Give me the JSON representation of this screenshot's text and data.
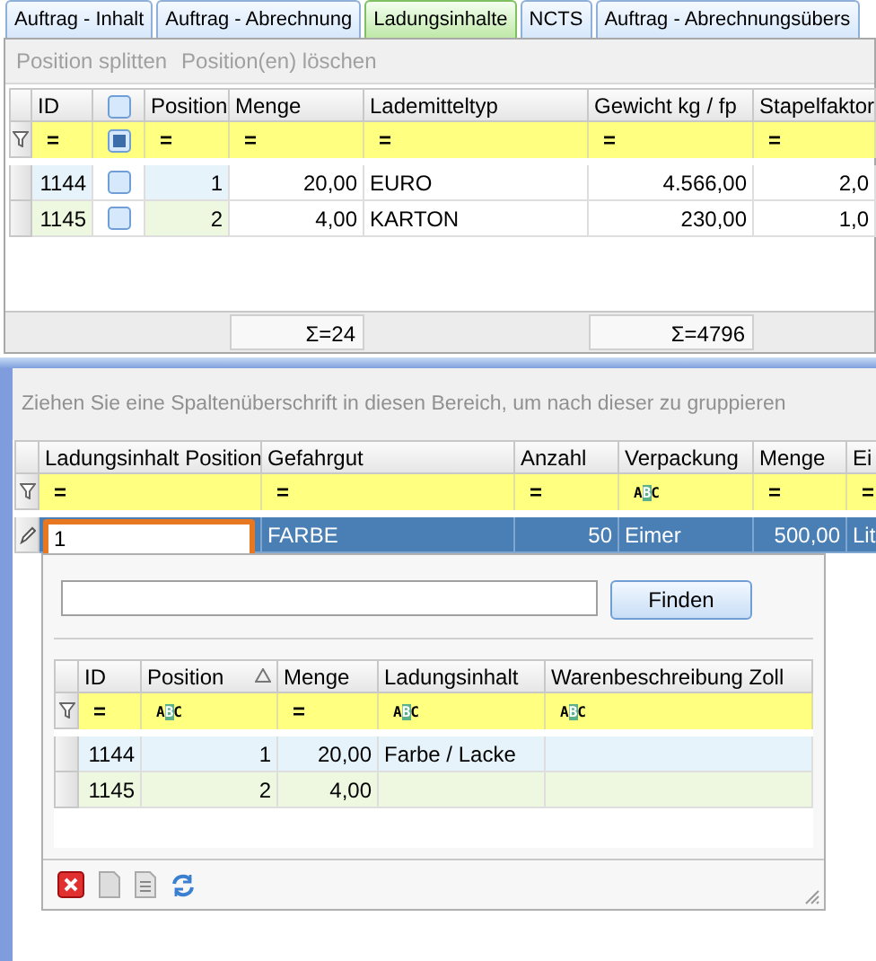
{
  "tabs": [
    {
      "label": "Auftrag - Inhalt",
      "selected": false
    },
    {
      "label": "Auftrag - Abrechnung",
      "selected": false
    },
    {
      "label": "Ladungsinhalte",
      "selected": true
    },
    {
      "label": "NCTS",
      "selected": false
    },
    {
      "label": "Auftrag - Abrechnungsübers",
      "selected": false
    }
  ],
  "toolbar": [
    {
      "label": "Position splitten",
      "disabled": true
    },
    {
      "label": "Position(en) löschen",
      "disabled": true
    }
  ],
  "load_grid": {
    "columns": [
      {
        "label": "ID"
      },
      {
        "kind": "checkbox",
        "checked": false
      },
      {
        "label": "Position"
      },
      {
        "label": "Menge",
        "sum": "Σ=24"
      },
      {
        "label": "Lademitteltyp"
      },
      {
        "label": "Gewicht kg / fp",
        "sum": "Σ=4796"
      },
      {
        "label": "Stapelfaktor"
      }
    ],
    "filters": [
      {
        "kind": "operator",
        "text": "="
      },
      {
        "kind": "checkbox",
        "indeterminate": true
      },
      {
        "kind": "operator",
        "text": "="
      },
      {
        "kind": "operator",
        "text": "="
      },
      {
        "kind": "operator",
        "text": "="
      },
      {
        "kind": "operator",
        "text": "="
      },
      {
        "kind": "operator",
        "text": "="
      }
    ],
    "rows": [
      {
        "cells": [
          "1144",
          {
            "checked": false
          },
          "1",
          "20,00",
          "EURO",
          "4.566,00",
          "2,0"
        ]
      },
      {
        "cells": [
          "1145",
          {
            "checked": false
          },
          "2",
          "4,00",
          "KARTON",
          "230,00",
          "1,0"
        ]
      }
    ]
  },
  "group_panel": {
    "hint": "Ziehen Sie eine Spaltenüberschrift in diesen Bereich, um nach dieser zu gruppieren"
  },
  "goods_grid": {
    "columns": [
      {
        "label": "Ladungsinhalt Position"
      },
      {
        "label": "Gefahrgut"
      },
      {
        "label": "Anzahl"
      },
      {
        "label": "Verpackung"
      },
      {
        "label": "Menge"
      },
      {
        "label": "Ei"
      }
    ],
    "filters": [
      {
        "kind": "operator",
        "text": "="
      },
      {
        "kind": "operator",
        "text": "="
      },
      {
        "kind": "operator",
        "text": "="
      },
      {
        "kind": "contains",
        "text": "ABC"
      },
      {
        "kind": "operator",
        "text": "="
      },
      {
        "kind": "operator",
        "text": "="
      }
    ],
    "rows": [
      {
        "selected": true,
        "editing": true,
        "cells": [
          "1",
          "FARBE",
          "50",
          "Eimer",
          "500,00",
          "Lit"
        ]
      }
    ]
  },
  "lookup": {
    "find_button": "Finden",
    "grid": {
      "columns": [
        {
          "label": "ID"
        },
        {
          "label": "Position",
          "sorted_ascending": true
        },
        {
          "label": "Menge"
        },
        {
          "label": "Ladungsinhalt"
        },
        {
          "label": "Warenbeschreibung Zoll"
        }
      ],
      "filters": [
        {
          "kind": "operator",
          "text": "="
        },
        {
          "kind": "contains",
          "text": "ABC"
        },
        {
          "kind": "operator",
          "text": "="
        },
        {
          "kind": "contains",
          "text": "ABC"
        },
        {
          "kind": "contains",
          "text": "ABC"
        }
      ],
      "rows": [
        {
          "cells": [
            "1144",
            "1",
            "20,00",
            "Farbe / Lacke"
          ]
        },
        {
          "cells": [
            "1145",
            "2",
            "4,00"
          ]
        }
      ]
    }
  }
}
